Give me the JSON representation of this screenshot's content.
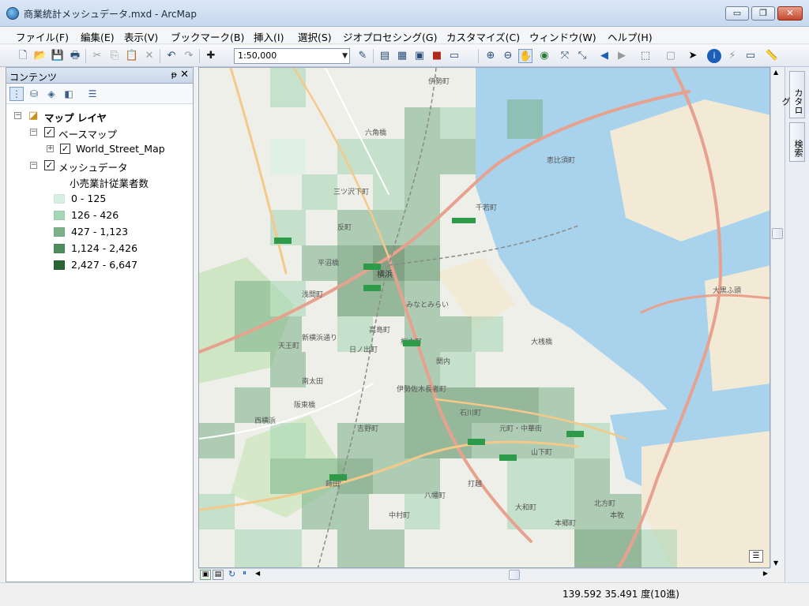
{
  "window": {
    "title": "商業統計メッシュデータ.mxd - ArcMap",
    "minimize": "▭",
    "maximize": "❐",
    "close": "✕"
  },
  "menu": [
    "ファイル(F)",
    "編集(E)",
    "表示(V)",
    "ブックマーク(B)",
    "挿入(I)",
    "選択(S)",
    "ジオプロセシング(G)",
    "カスタマイズ(C)",
    "ウィンドウ(W)",
    "ヘルプ(H)"
  ],
  "toolbar": {
    "scale": "1:50,000",
    "icons": [
      "new-document-icon",
      "open-folder-icon",
      "save-icon",
      "print-icon",
      "cut-icon",
      "copy-icon",
      "paste-icon",
      "delete-icon",
      "undo-icon",
      "redo-icon",
      "add-data-icon",
      "editor-icon",
      "table-window-icon",
      "layout-icon",
      "catalog-icon",
      "arctoolbox-icon",
      "python-icon",
      "zoom-in-icon",
      "zoom-out-icon",
      "pan-icon",
      "full-extent-icon",
      "fixed-zoom-in-icon",
      "fixed-zoom-out-icon",
      "back-icon",
      "forward-icon",
      "select-features-icon",
      "clear-selection-icon",
      "select-element-icon",
      "identify-icon",
      "hyperlink-icon",
      "html-popup-icon",
      "measure-icon"
    ]
  },
  "toc": {
    "title": "コンテンツ",
    "pin": "ᵽ",
    "close": "✕",
    "root": "マップ レイヤ",
    "basemap_group": "ベースマップ",
    "basemap_layer": "World_Street_Map",
    "mesh_layer": "メッシュデータ",
    "field_label": "小売業計従業者数",
    "legend": [
      {
        "label": "0 - 125",
        "color": "#d6f1e3"
      },
      {
        "label": "126 - 426",
        "color": "#a6d6b5"
      },
      {
        "label": "427 - 1,123",
        "color": "#7ab189"
      },
      {
        "label": "1,124 - 2,426",
        "color": "#4f8c5c"
      },
      {
        "label": "2,427 - 6,647",
        "color": "#2a6434"
      }
    ]
  },
  "dock": {
    "catalog": "カタログ",
    "search": "検索"
  },
  "map": {
    "labels": [
      "伊勢町",
      "六角橋",
      "三ツ沢下町",
      "反町",
      "横浜",
      "みなとみらい",
      "桜木町",
      "関内",
      "伊勢佐木長者町",
      "石川町",
      "元町・中華街",
      "山下町",
      "本牧",
      "大黒ふ頭",
      "千若町",
      "恵比須町",
      "大桟橋",
      "日ノ出町",
      "阪東橋",
      "吉野町",
      "蒔田",
      "南太田",
      "天王町",
      "西横浜",
      "平沼橋",
      "浅間町",
      "高島町",
      "新横浜通り",
      "中村町",
      "八幡町",
      "打越",
      "大和町",
      "本郷町",
      "北方町"
    ]
  },
  "status": {
    "coords": "139.592  35.491 度(10進)"
  }
}
